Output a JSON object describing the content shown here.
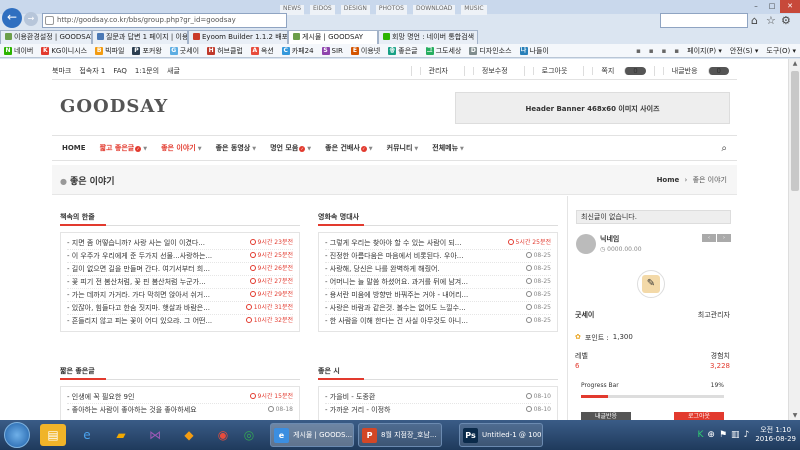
{
  "browser": {
    "address": "http://goodsay.co.kr/bbs/group.php?gr_id=goodsay",
    "search_placeholder": "",
    "menu_top": [
      "NEWS",
      "EIDOS",
      "DESIGN",
      "PHOTOS",
      "DOWNLOAD",
      "MUSIC"
    ],
    "tabs": [
      {
        "label": "이용환경설정 | GOODSAY",
        "color": "#6c9f4a"
      },
      {
        "label": "질문과 답변 1 페이지 | 이용",
        "color": "#4a78b5"
      },
      {
        "label": "Eyoom Builder 1.1.2 배포 및",
        "color": "#c93a2a"
      },
      {
        "label": "게시물 | GOODSAY",
        "color": "#6c9f4a"
      },
      {
        "label": "회망 명언 : 네이버 통합검색",
        "color": "#2db400"
      }
    ],
    "bookmarks": [
      {
        "label": "네이버",
        "color": "#2db400",
        "g": "N"
      },
      {
        "label": "KG이니시스",
        "color": "#e23a2e",
        "g": "K"
      },
      {
        "label": "빅파일",
        "color": "#f39c12",
        "g": "B"
      },
      {
        "label": "포커왕",
        "color": "#2c3e50",
        "g": "P"
      },
      {
        "label": "굿세이",
        "color": "#5dade2",
        "g": "G"
      },
      {
        "label": "허브클럽",
        "color": "#c0392b",
        "g": "H"
      },
      {
        "label": "옥션",
        "color": "#e74c3c",
        "g": "A"
      },
      {
        "label": "카페24",
        "color": "#3498db",
        "g": "C"
      },
      {
        "label": "SIR",
        "color": "#8e44ad",
        "g": "S"
      },
      {
        "label": "이용넷",
        "color": "#d35400",
        "g": "E"
      },
      {
        "label": "좋은글",
        "color": "#16a085",
        "g": "좋"
      },
      {
        "label": "그도세상",
        "color": "#27ae60",
        "g": "그"
      },
      {
        "label": "디자인소스",
        "color": "#7f8c8d",
        "g": "D"
      },
      {
        "label": "나들이",
        "color": "#2980b9",
        "g": "나"
      }
    ],
    "tools": [
      "페이지(P)",
      "안전(S)",
      "도구(O)"
    ]
  },
  "site": {
    "top_left": [
      "북마크",
      "접속자 1",
      "FAQ",
      "1:1문의",
      "새글"
    ],
    "top_right": [
      {
        "label": "관리자"
      },
      {
        "label": "정보수정"
      },
      {
        "label": "로그아웃"
      },
      {
        "label": "쪽지",
        "badge": "0"
      },
      {
        "label": "내글반응",
        "badge": "0"
      }
    ],
    "logo": "GOODSAY",
    "banner": "Header Banner 468x60 이미지 사이즈",
    "nav": [
      {
        "label": "HOME",
        "red": false,
        "dd": false,
        "hot": false
      },
      {
        "label": "짧고 좋은글",
        "red": true,
        "dd": true,
        "hot": true
      },
      {
        "label": "좋은 이야기",
        "red": true,
        "dd": true,
        "hot": false
      },
      {
        "label": "좋은 동영상",
        "red": false,
        "dd": true,
        "hot": false
      },
      {
        "label": "명언 모음",
        "red": false,
        "dd": true,
        "hot": true
      },
      {
        "label": "좋은 건배사",
        "red": false,
        "dd": true,
        "hot": true
      },
      {
        "label": "커뮤니티",
        "red": false,
        "dd": true,
        "hot": false
      },
      {
        "label": "전체메뉴",
        "red": false,
        "dd": true,
        "hot": false
      }
    ],
    "page_title": "좋은 이야기",
    "crumb_home": "Home",
    "crumb_sep": "›",
    "crumb_current": "좋은 이야기"
  },
  "boards": [
    {
      "title": "책속의 한줄",
      "rows": [
        {
          "t": "- 지면 좀 어떻습니까? 사랑 사는 일이 이겼다...",
          "d": "9시간 23분전",
          "red": true
        },
        {
          "t": "- 이 우주가 우리에게 준 두가지 선물...사랑하는...",
          "d": "9시간 25분전",
          "red": true
        },
        {
          "t": "- 길이 없으면 길을 만들며 간다. 여기서부터 희...",
          "d": "9시간 26분전",
          "red": true
        },
        {
          "t": "- 꽃 피기 전 봄산처럼, 꽃 핀 봄산처럼 누군가...",
          "d": "9시간 27분전",
          "red": true
        },
        {
          "t": "- 가는 데까지 가거라. 가다 막히면 앉아서 쉬거...",
          "d": "9시간 29분전",
          "red": true
        },
        {
          "t": "- 있잖아, 힘들다고 한숨 짓지마. 햇살과 바람은...",
          "d": "10시간 31분전",
          "red": true
        },
        {
          "t": "- 흔들리지 않고 피는 꽃이 어디 있으랴. 그 어떤...",
          "d": "10시간 32분전",
          "red": true
        }
      ]
    },
    {
      "title": "영화속 명대사",
      "rows": [
        {
          "t": "- 그렇게 우리는 찾아야 할 수 있는 사람이 되...",
          "d": "5시간 25분전",
          "red": true
        },
        {
          "t": "- 진정한 아름다움은 마음에서 비롯된다. 우아...",
          "d": "08-25",
          "red": false
        },
        {
          "t": "- 사랑해, 당신은 나를 완벽하게 해줬어.",
          "d": "08-25",
          "red": false
        },
        {
          "t": "- 어머니는 늘 말씀 하셨어요. 과거를 뒤에 남겨...",
          "d": "08-25",
          "red": false
        },
        {
          "t": "- 용서란 미움에 방향만 바꿔주는 거야 - 내어리...",
          "d": "08-25",
          "red": false
        },
        {
          "t": "- 사랑은 바람과 같은것. 볼수는 없어도 느낄수...",
          "d": "08-25",
          "red": false
        },
        {
          "t": "- 한 사람을 이해 한다는 건 사실 아무것도 아니...",
          "d": "08-25",
          "red": false
        }
      ]
    },
    {
      "title": "짧은 좋은글",
      "rows": [
        {
          "t": "- 인생에 꼭 필요한 9인",
          "d": "9시간 15분전",
          "red": true
        },
        {
          "t": "- 좋아하는 사람이 좋아하는 것을 좋아하세요",
          "d": "08-18",
          "red": false
        }
      ]
    },
    {
      "title": "좋은 시",
      "rows": [
        {
          "t": "- 가을비 - 도종환",
          "d": "08-10",
          "red": false
        },
        {
          "t": "- 가까운 거리 - 이정하",
          "d": "08-10",
          "red": false
        }
      ]
    }
  ],
  "sidebar": {
    "recent": "최신글이 없습니다.",
    "nick": "닉네임",
    "points_small": "0000.00.00",
    "member_name": "굿세이",
    "member_role": "최고관리자",
    "point_label": "포인트 :",
    "point_value": "1,300",
    "level_label": "레벨",
    "level_value": "6",
    "exp_label": "경험치",
    "exp_value": "3,228",
    "progress_label": "Progress Bar",
    "progress_value": "19%",
    "progress_fraction": 0.19,
    "btn_left": "내글반응",
    "btn_right": "로그아웃"
  },
  "taskbar": {
    "tasks": [
      {
        "label": "게시물 | GOODS...",
        "g": "e",
        "color": "#3b8ee0"
      },
      {
        "label": "8월 지점장_호남...",
        "g": "P",
        "color": "#d24726"
      },
      {
        "label": "Untitled-1 @ 100...",
        "g": "Ps",
        "color": "#0a2a4a"
      }
    ],
    "time": "오전 1:10",
    "date": "2016-08-29"
  },
  "colors": {
    "accent": "#e23a2e",
    "nav_bg": "#ffffff"
  }
}
